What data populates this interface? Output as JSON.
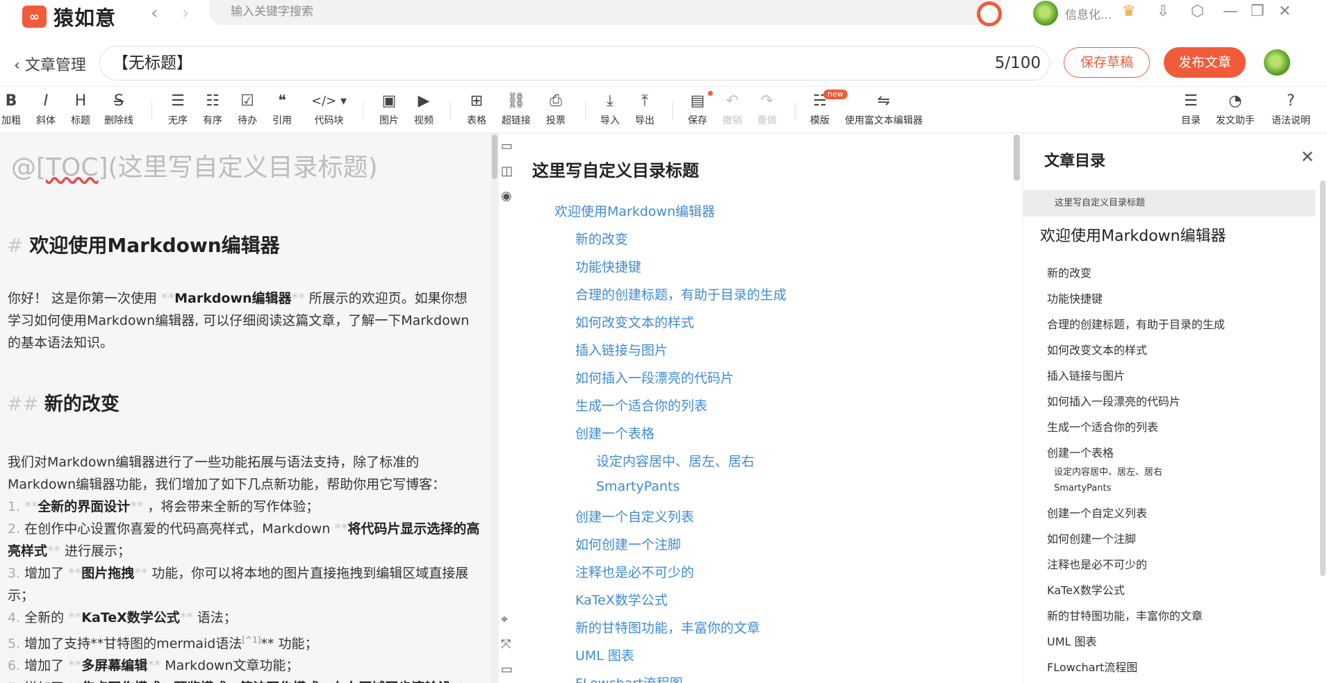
{
  "app": {
    "logo_glyph": "∞",
    "name": "猿如意",
    "back_arrow": "‹",
    "forward_arrow": "›",
    "search_placeholder": "输入关键字搜索",
    "user_name": "信息化...",
    "icons": [
      "crown-icon",
      "download-icon",
      "settings-icon",
      "minimize-icon",
      "maximize-icon",
      "close-icon"
    ],
    "icon_glyphs": {
      "crown": "♛",
      "download": "⇩",
      "settings": "⬡",
      "minimize": "—",
      "maximize": "❐",
      "close": "✕"
    }
  },
  "header": {
    "back_label": "文章管理",
    "title_value": "【无标题】",
    "title_count": "5/100",
    "save_draft": "保存草稿",
    "publish": "发布文章"
  },
  "toolbar": {
    "bold": {
      "icon": "B",
      "label": "加粗"
    },
    "italic": {
      "icon": "I",
      "label": "斜体"
    },
    "heading": {
      "icon": "H",
      "label": "标题"
    },
    "strike": {
      "icon": "S",
      "label": "删除线"
    },
    "ul": {
      "icon": "☰",
      "label": "无序"
    },
    "ol": {
      "icon": "☷",
      "label": "有序"
    },
    "todo": {
      "icon": "☑",
      "label": "待办"
    },
    "quote": {
      "icon": "❝",
      "label": "引用"
    },
    "code": {
      "icon": "</> ▾",
      "label": "代码块"
    },
    "image": {
      "icon": "▣",
      "label": "图片"
    },
    "video": {
      "icon": "▶",
      "label": "视频"
    },
    "table": {
      "icon": "⊞",
      "label": "表格"
    },
    "link": {
      "icon": "⛓",
      "label": "超链接"
    },
    "vote": {
      "icon": "⎙",
      "label": "投票"
    },
    "import": {
      "icon": "⤓",
      "label": "导入"
    },
    "export": {
      "icon": "⤒",
      "label": "导出"
    },
    "save": {
      "icon": "▤",
      "label": "保存"
    },
    "undo": {
      "icon": "↶",
      "label": "撤销"
    },
    "redo": {
      "icon": "↷",
      "label": "重做"
    },
    "template": {
      "icon": "☵",
      "label": "模版",
      "badge": "new"
    },
    "rich": {
      "icon": "⇋",
      "label": "使用富文本编辑器"
    },
    "toc": {
      "icon": "☰",
      "label": "目录"
    },
    "assist": {
      "icon": "◔",
      "label": "发文助手"
    },
    "grammar": {
      "icon": "?",
      "label": "语法说明"
    }
  },
  "editor": {
    "toc_line_prefix": "@[",
    "toc_line_word": "TOC",
    "toc_line_suffix": "](这里写自定义目录标题)",
    "h1_mark": "# ",
    "h1_text": "欢迎使用Markdown编辑器",
    "intro_1": "你好！ 这是你第一次使用 ",
    "intro_bold": "Markdown编辑器",
    "intro_2": " 所展示的欢迎页。如果你想学习如何使用Markdown编辑器, 可以仔细阅读这篇文章，了解一下Markdown的基本语法知识。",
    "h2_mark": "## ",
    "h2_text": "新的改变",
    "para2": "我们对Markdown编辑器进行了一些功能拓展与语法支持，除了标准的Markdown编辑器功能，我们增加了如下几点新功能，帮助你用它写博客：",
    "bold_mark": "**",
    "list": [
      {
        "num": "1.",
        "pre": " ",
        "bold": "全新的界面设计",
        "post": " ，将会带来全新的写作体验；"
      },
      {
        "num": "2.",
        "pre": " 在创作中心设置你喜爱的代码高亮样式，Markdown ",
        "bold": "将代码片显示选择的高亮样式",
        "post": " 进行展示；"
      },
      {
        "num": "3.",
        "pre": " 增加了 ",
        "bold": "图片拖拽",
        "post": " 功能，你可以将本地的图片直接拖拽到编辑区域直接展示；"
      },
      {
        "num": "4.",
        "pre": " 全新的 ",
        "bold": "KaTeX数学公式",
        "post": " 语法；"
      },
      {
        "num": "5.",
        "pre": " 增加了支持**甘特图的mermaid语法",
        "sup": "[^1]",
        "post": "** 功能；"
      },
      {
        "num": "6.",
        "pre": " 增加了 ",
        "bold": "多屏幕编辑",
        "post": " Markdown文章功能；"
      },
      {
        "num": "7.",
        "pre": " 增加了 ",
        "bold": "焦点写作模式、预览模式、简洁写作模式、左右区域同步滚轮设",
        "post": ""
      }
    ]
  },
  "strip_icons": [
    "▭",
    "◫",
    "◉",
    "⌖",
    "⤧",
    "▭"
  ],
  "preview": {
    "title": "这里写自定义目录标题",
    "links": [
      {
        "text": "欢迎使用Markdown编辑器",
        "level": 1
      },
      {
        "text": "新的改变",
        "level": 2
      },
      {
        "text": "功能快捷键",
        "level": 2
      },
      {
        "text": "合理的创建标题，有助于目录的生成",
        "level": 2
      },
      {
        "text": "如何改变文本的样式",
        "level": 2
      },
      {
        "text": "插入链接与图片",
        "level": 2
      },
      {
        "text": "如何插入一段漂亮的代码片",
        "level": 2
      },
      {
        "text": "生成一个适合你的列表",
        "level": 2
      },
      {
        "text": "创建一个表格",
        "level": 2
      },
      {
        "text": "设定内容居中、居左、居右",
        "level": 3
      },
      {
        "text": "SmartyPants",
        "level": 3
      },
      {
        "text": "创建一个自定义列表",
        "level": 2
      },
      {
        "text": "如何创建一个注脚",
        "level": 2
      },
      {
        "text": "注释也是必不可少的",
        "level": 2
      },
      {
        "text": "KaTeX数学公式",
        "level": 2
      },
      {
        "text": "新的甘特图功能，丰富你的文章",
        "level": 2
      },
      {
        "text": "UML 图表",
        "level": 2
      },
      {
        "text": "FLowchart流程图",
        "level": 2
      }
    ]
  },
  "toc": {
    "heading": "文章目录",
    "close": "✕",
    "selected": "这里写自定义目录标题",
    "h1": "欢迎使用Markdown编辑器",
    "items": [
      {
        "text": "新的改变",
        "sub": false
      },
      {
        "text": "功能快捷键",
        "sub": false
      },
      {
        "text": "合理的创建标题，有助于目录的生成",
        "sub": false
      },
      {
        "text": "如何改变文本的样式",
        "sub": false
      },
      {
        "text": "插入链接与图片",
        "sub": false
      },
      {
        "text": "如何插入一段漂亮的代码片",
        "sub": false
      },
      {
        "text": "生成一个适合你的列表",
        "sub": false
      },
      {
        "text": "创建一个表格",
        "sub": false
      },
      {
        "text": "设定内容居中、居左、居右",
        "sub": true
      },
      {
        "text": "SmartyPants",
        "sub": true
      },
      {
        "text": "创建一个自定义列表",
        "sub": false
      },
      {
        "text": "如何创建一个注脚",
        "sub": false
      },
      {
        "text": "注释也是必不可少的",
        "sub": false
      },
      {
        "text": "KaTeX数学公式",
        "sub": false
      },
      {
        "text": "新的甘特图功能，丰富你的文章",
        "sub": false
      },
      {
        "text": "UML 图表",
        "sub": false
      },
      {
        "text": "FLowchart流程图",
        "sub": false
      }
    ]
  },
  "colors": {
    "accent": "#f05b3a",
    "link": "#3f8bd4"
  }
}
